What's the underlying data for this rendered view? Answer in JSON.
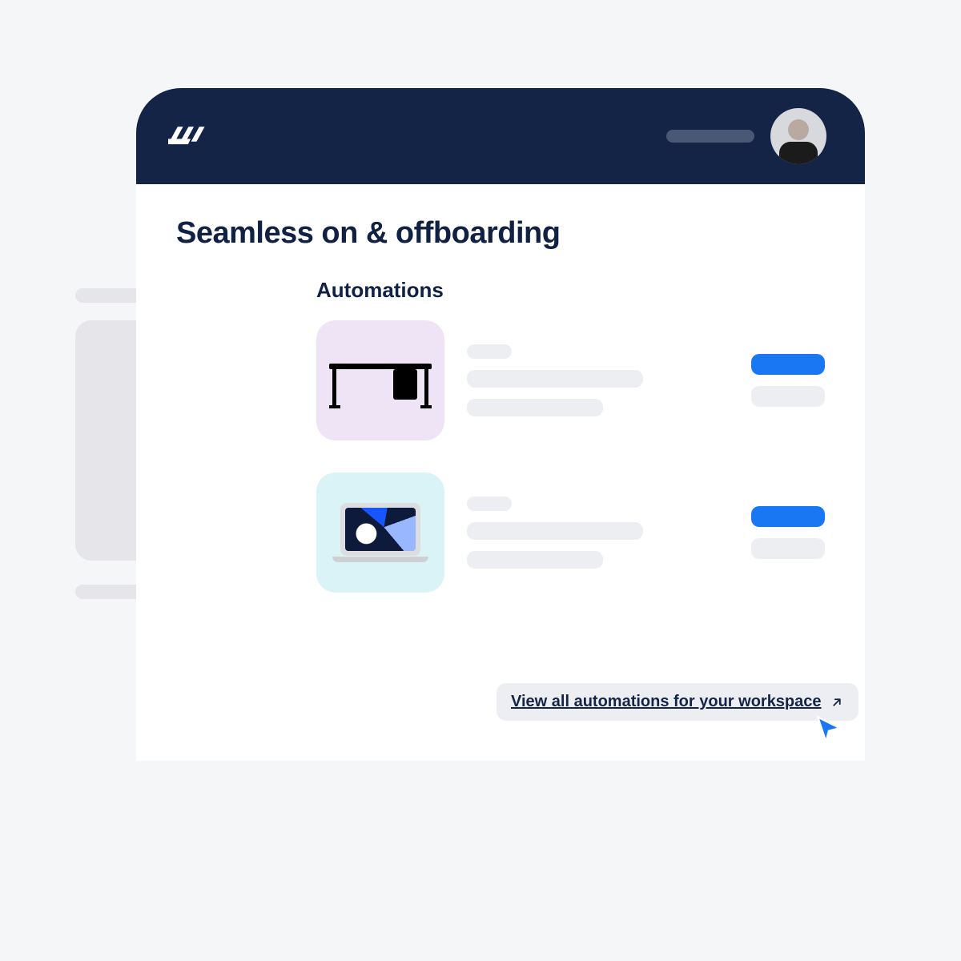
{
  "header": {
    "product": "workwize",
    "avatar_alt": "User avatar"
  },
  "page": {
    "title": "Seamless on & offboarding",
    "section_title": "Automations"
  },
  "automations": [
    {
      "thumb": "desk",
      "thumb_bg": "purple",
      "alt": "Office desk"
    },
    {
      "thumb": "laptop",
      "thumb_bg": "cyan",
      "alt": "Laptop"
    }
  ],
  "cta": {
    "view_all": "View all automations for your workspace"
  },
  "colors": {
    "brand_navy": "#132447",
    "accent_blue": "#1977f3",
    "placeholder": "#edeef1"
  }
}
